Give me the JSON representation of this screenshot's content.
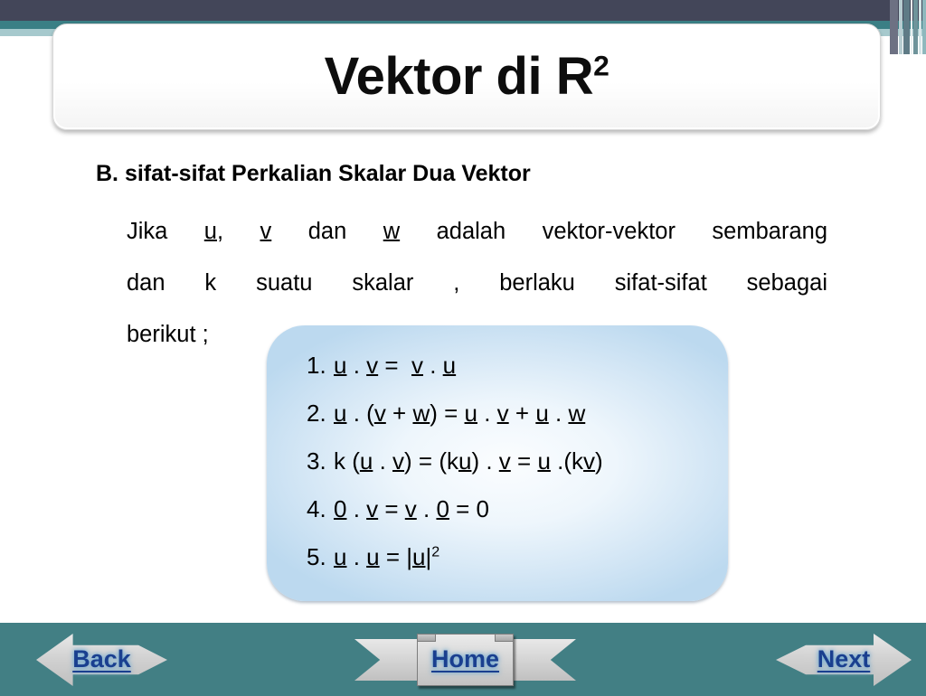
{
  "theme": {
    "band_dark": "#434659",
    "band_teal": "#3b7f85",
    "band_light_teal": "#a6c9cd",
    "navbar_teal": "#427f84",
    "blue_box": "#cfe4f4",
    "nav_label_color": "#1a3f8f"
  },
  "title": {
    "main": "Vektor di R",
    "sup": "2"
  },
  "body": {
    "heading": "B. sifat-sifat Perkalian Skalar Dua Vektor",
    "line1_a": "Jika ",
    "line1_u": "u",
    "line1_b": ", ",
    "line1_v": "v",
    "line1_c": " dan ",
    "line1_w": "w",
    "line1_d": " adalah vektor-vektor sembarang",
    "line2": "dan k suatu skalar , berlaku sifat-sifat sebagai",
    "line3": "berikut ;"
  },
  "properties": [
    {
      "num": "1.",
      "text": "u . v =  v . u"
    },
    {
      "num": "2.",
      "text": "u . (v + w) = u . v + u . w"
    },
    {
      "num": "3.",
      "text": "k (u . v) = (ku) . v = u .(kv)"
    },
    {
      "num": "4.",
      "text": "0 . v = v . 0 = 0"
    },
    {
      "num": "5.",
      "text": "u . u = |u|2"
    }
  ],
  "nav": {
    "back": "Back",
    "home": "Home",
    "next": "Next"
  }
}
